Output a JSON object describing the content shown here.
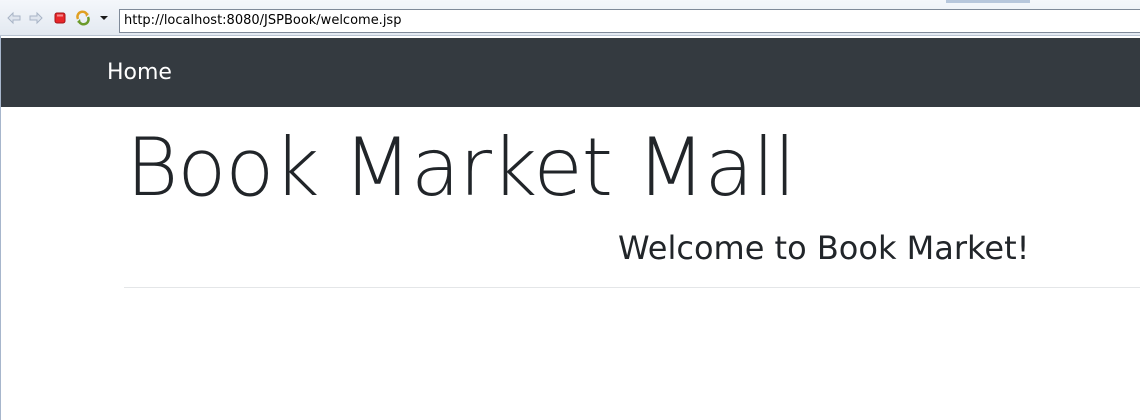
{
  "toolbar": {
    "url": "http://localhost:8080/JSPBook/welcome.jsp",
    "icons": [
      "back-arrow-icon",
      "forward-arrow-icon",
      "stop-icon",
      "refresh-icon",
      "dropdown-arrow-icon"
    ]
  },
  "navbar": {
    "home_label": "Home",
    "background": "#343a40"
  },
  "main": {
    "title": "Book Market Mall",
    "subtitle": "Welcome to Book Market!"
  }
}
